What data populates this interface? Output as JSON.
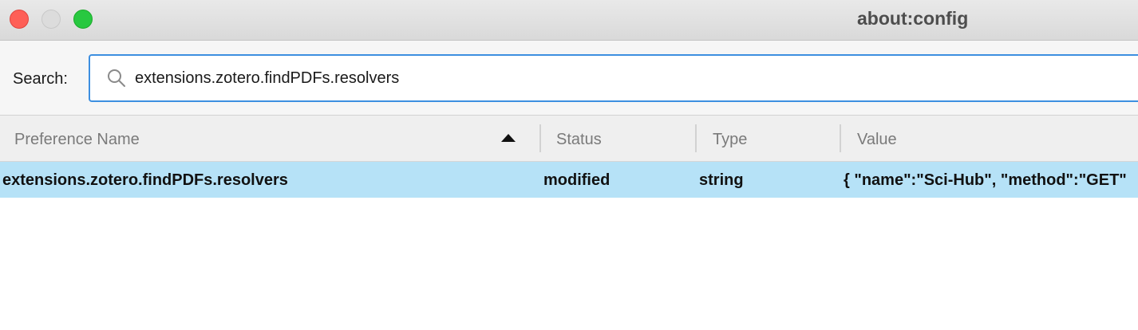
{
  "window": {
    "title": "about:config"
  },
  "search": {
    "label": "Search:",
    "value": "extensions.zotero.findPDFs.resolvers"
  },
  "table": {
    "columns": [
      {
        "label": "Preference Name",
        "sorted": "ascending"
      },
      {
        "label": "Status"
      },
      {
        "label": "Type"
      },
      {
        "label": "Value"
      }
    ],
    "rows": [
      {
        "name": "extensions.zotero.findPDFs.resolvers",
        "status": "modified",
        "type": "string",
        "value": "{ \"name\":\"Sci-Hub\", \"method\":\"GET\"",
        "selected": true
      }
    ]
  },
  "colors": {
    "close": "#fe5f57",
    "minimize": "#dcdcdc",
    "zoom": "#28c840",
    "focus_ring": "#3d8fe0",
    "selection": "#b6e2f7"
  }
}
